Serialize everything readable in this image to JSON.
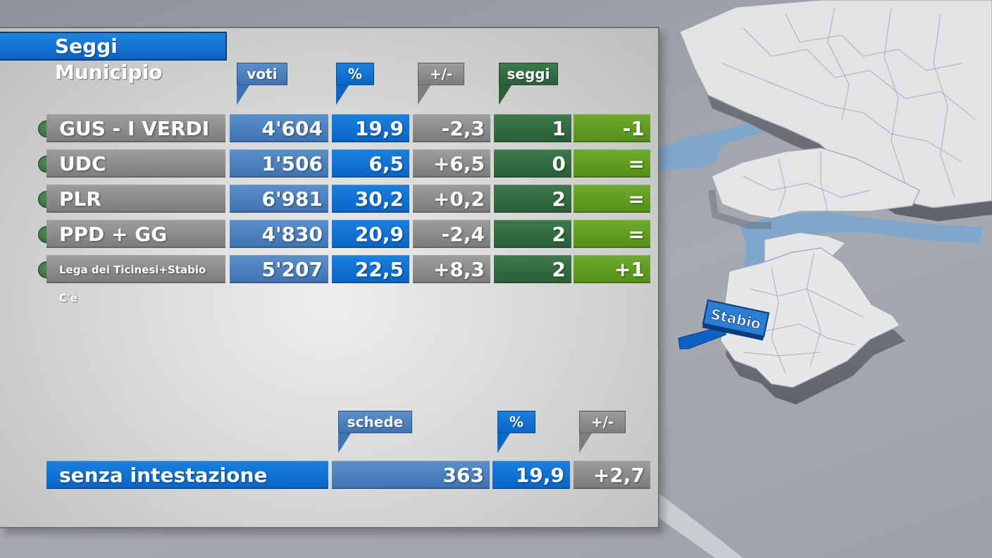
{
  "title": "Seggi Municipio",
  "headers": {
    "voti": "voti",
    "pct": "%",
    "diff": "+/-",
    "seggi": "seggi"
  },
  "rows": [
    {
      "party": "GUS - I VERDI",
      "voti": "4'604",
      "pct": "19,9",
      "diff": "-2,3",
      "seggi": "1",
      "seggi_diff": "-1"
    },
    {
      "party": "UDC",
      "voti": "1'506",
      "pct": "6,5",
      "diff": "+6,5",
      "seggi": "0",
      "seggi_diff": "="
    },
    {
      "party": "PLR",
      "voti": "6'981",
      "pct": "30,2",
      "diff": "+0,2",
      "seggi": "2",
      "seggi_diff": "="
    },
    {
      "party": "PPD + GG",
      "voti": "4'830",
      "pct": "20,9",
      "diff": "-2,4",
      "seggi": "2",
      "seggi_diff": "="
    },
    {
      "party": "Lega dei Ticinesi+Stabio C'è",
      "voti": "5'207",
      "pct": "22,5",
      "diff": "+8,3",
      "seggi": "2",
      "seggi_diff": "+1"
    }
  ],
  "bottom_headers": {
    "schede": "schede",
    "pct": "%",
    "diff": "+/-"
  },
  "bottom_row": {
    "label": "senza intestazione",
    "schede": "363",
    "pct": "19,9",
    "diff": "+2,7"
  },
  "map": {
    "marker_label": "Stabio"
  },
  "colors": {
    "accent_blue": "#0b66c6",
    "voti_blue": "#4a7fbd",
    "seggi_green": "#2f6a3d",
    "seggi_diff_green": "#62a022",
    "grey": "#8a8a8a",
    "party_dot": "#2f6e3a"
  }
}
